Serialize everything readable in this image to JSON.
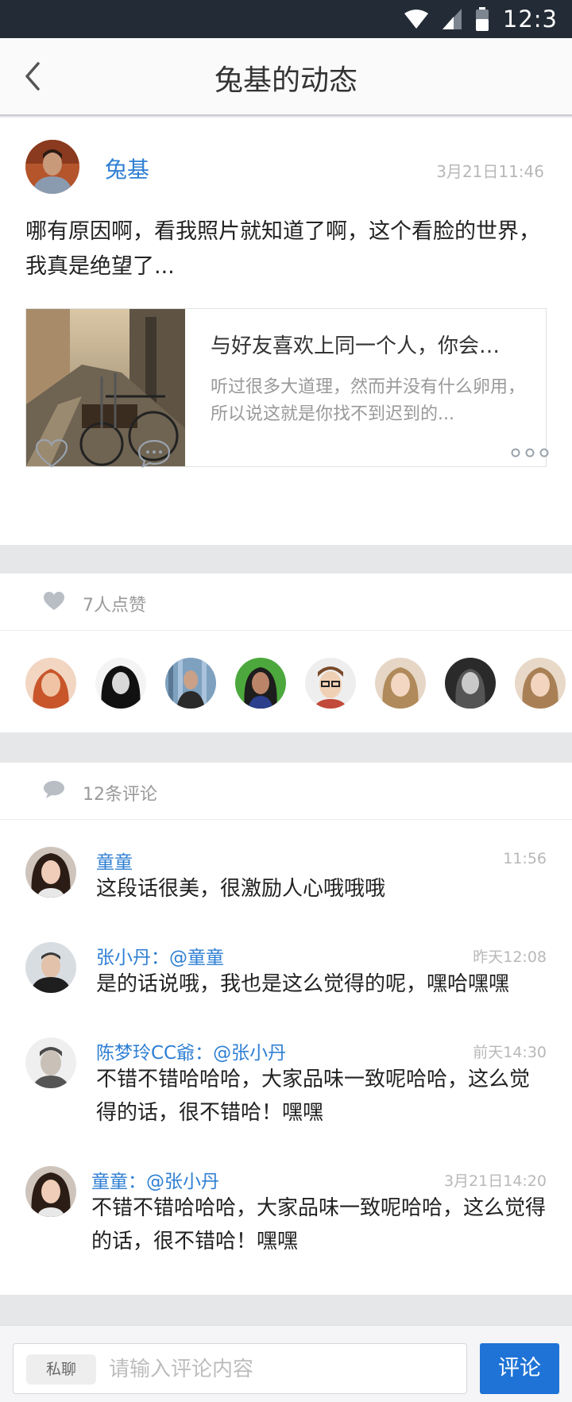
{
  "status_bar": {
    "time": "12:3"
  },
  "nav": {
    "title": "兔基的动态"
  },
  "post": {
    "author": "兔基",
    "time": "3月21日11:46",
    "content": "哪有原因啊，看我照片就知道了啊，这个看脸的世界，我真是绝望了...",
    "link": {
      "title": "与好友喜欢上同一个人，你会…",
      "desc": "听过很多大道理，然而并没有什么卵用，所以说这就是你找不到迟到的..."
    }
  },
  "likes": {
    "label": "7人点赞",
    "avatar_count": 8
  },
  "comments": {
    "label": "12条评论",
    "items": [
      {
        "name": "童童",
        "time": "11:56",
        "text": "这段话很美，很激励人心哦哦哦"
      },
      {
        "name": "张小丹：@童童",
        "time": "昨天12:08",
        "text": "是的话说哦，我也是这么觉得的呢，嘿哈嘿嘿"
      },
      {
        "name": "陈梦玲CC爺：@张小丹",
        "time": "前天14:30",
        "text": "不错不错哈哈哈，大家品味一致呢哈哈，这么觉得的话，很不错哈！嘿嘿"
      },
      {
        "name": "童童：@张小丹",
        "time": "3月21日14:20",
        "text": "不错不错哈哈哈，大家品味一致呢哈哈，这么觉得的话，很不错哈！嘿嘿"
      }
    ]
  },
  "bottom": {
    "private_label": "私聊",
    "input_placeholder": "请输入评论内容",
    "send_label": "评论"
  },
  "colors": {
    "accent": "#1f73d6",
    "link": "#2f7fd3",
    "statusbar": "#232b36"
  }
}
